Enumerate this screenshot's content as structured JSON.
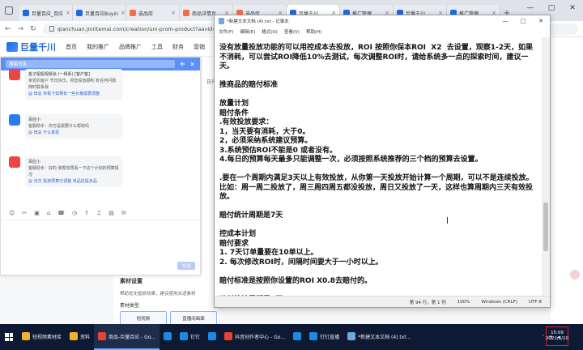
{
  "browser": {
    "tabs": [
      {
        "label": "巨量百应_百应",
        "color": "#1d6ae5"
      },
      {
        "label": "巨量百应Buyin",
        "color": "#1d6ae5"
      },
      {
        "label": "选品库",
        "color": "#ff6a3d"
      },
      {
        "label": "商品详情页",
        "color": "#ff6a3d"
      },
      {
        "label": "选品库",
        "color": "#ff6a3d"
      },
      {
        "label": "巨量千川",
        "color": "#1d6ae5"
      },
      {
        "label": "推广管理",
        "color": "#1d6ae5"
      },
      {
        "label": "巨量千川",
        "color": "#1d6ae5"
      },
      {
        "label": "推广管理",
        "color": "#1d6ae5"
      }
    ],
    "url": "qianchuan.jinritemai.com/creation/uni-prom-product?aavid=1819428739058180&",
    "window_controls": [
      "—",
      "□",
      "✕"
    ]
  },
  "site": {
    "logo": "巨量千川",
    "nav": [
      "首页",
      "我的推广",
      "品牌推广",
      "工具",
      "财务",
      "营销"
    ]
  },
  "chat": {
    "search_placeholder": "搜索消息",
    "messages": [
      {
        "sender": "金子姐姐视频会 (一频系) [客户客]",
        "text": "亲爱的客户 节日快乐，祝您投放顺利 有任何问题随时联系我",
        "extra": "@ 田总  你看下如果有一些价格需要调整"
      },
      {
        "sender": "百应小",
        "text": "客服助手：你方是需要什么帮助吗",
        "extra": "@ 田总  什么意思"
      },
      {
        "sender": "百应小",
        "text": "客服助手：好的 我帮您再看一下这个计划的预算情况",
        "extra": "@ 光华  投放预算已调整 单品还是多品"
      }
    ],
    "tools": [
      "☺",
      "✂",
      "▣",
      "⌂",
      "☎",
      "◷",
      "⇪",
      "♫",
      "▤",
      "✉"
    ],
    "send_label": "发送"
  },
  "background_page": {
    "side_text": "日光小",
    "card_title": "素材设置",
    "card_text": "帮助优化投放效果，建议使用合适素材",
    "card_sub": "素材类型",
    "options": [
      "短视频",
      "直播间画面"
    ]
  },
  "notepad": {
    "title": "*新建文本文档 (4).txt - 记事本",
    "menu": [
      "文件(F)",
      "编辑(E)",
      "格式(O)",
      "查看(V)",
      "帮助(H)"
    ],
    "lines": [
      "没有放量投放功能的可以用控成本去投放，ROI 按照你保本ROI  X2  去设置，观察1-2天，如果不消耗，可以尝试ROI降低10%去测试，每次调整ROI时，请给系统多一点的探索时间，建议一天。",
      "",
      "推商品的赔付标准",
      "",
      "放量计划",
      "赔付条件",
      ".有效投放要求：",
      "1，当天要有消耗，大于0。",
      "2，必须采纳系统建议预算。",
      "3.系统预估ROI不能是0 或者没有。",
      "4.每日的预算每天最多只能调整一次，必须按照系统推荐的三个档的预算去设置。",
      "",
      ".要在一个周期内满足3天以上有效投放，从你第一天投放开始计算一个周期，可以不是连续投放。比如：周一周二投放了，周三周四周五都没投放，周日又投放了一天，这样也算周期内三天有效投放。",
      "",
      "赔付统计周期是7天",
      "",
      "控成本计划",
      "赔付要求",
      "1. 7天订单量要在10单以上。",
      "2. 每次修改ROI时，间隔时间要大于一小时以上。",
      "",
      "赔付标准是按照你设置的ROI X0.8去赔付的。",
      "",
      "赔付统计周期是7天。"
    ],
    "status": [
      "第 94 行，第 1 列",
      "100%",
      "Windows (CRLF)",
      "UTF-8"
    ]
  },
  "taskbar": {
    "items": [
      {
        "label": "短视频素材库",
        "color": "#f0b429",
        "active": false
      },
      {
        "label": "资料",
        "color": "#f0b429",
        "active": false
      },
      {
        "label": "商品-巨量百应 - Go...",
        "color": "#ea4335",
        "active": true
      },
      {
        "label": "",
        "color": "#1e88e5",
        "active": false
      },
      {
        "label": "钉钉",
        "color": "#1e88e5",
        "active": false
      },
      {
        "label": "",
        "color": "#1e88e5",
        "active": false
      },
      {
        "label": "抖音创作者中心 - Go...",
        "color": "#ea4335",
        "active": false
      },
      {
        "label": "",
        "color": "#1e88e5",
        "active": false
      },
      {
        "label": "钉钉直播",
        "color": "#1e88e5",
        "active": false
      },
      {
        "label": "*新建文本文档 (4).txt...",
        "color": "#6fa8dc",
        "active": false
      }
    ],
    "clock_time": "15:09",
    "clock_date": "2021/5/10"
  }
}
